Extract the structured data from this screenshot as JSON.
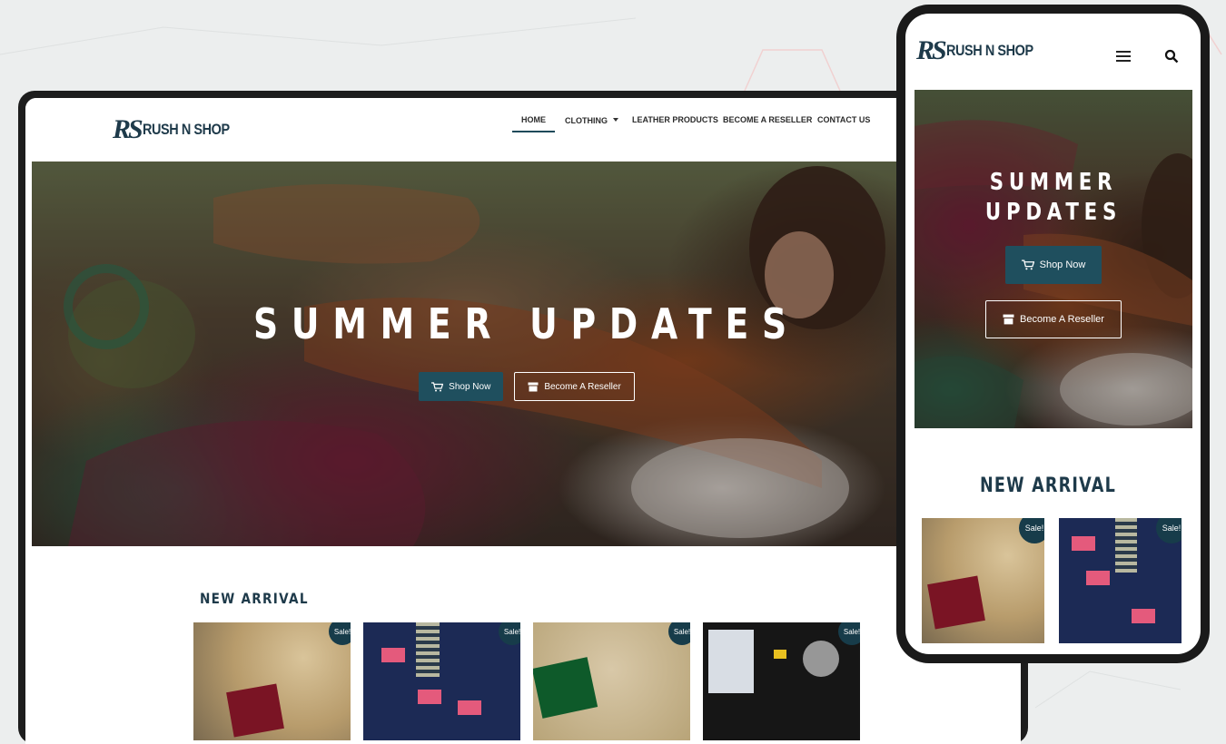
{
  "brand": {
    "logo_mark": "RS",
    "logo_text": "RUSH N SHOP"
  },
  "desktop": {
    "nav": [
      {
        "label": "HOME",
        "active": true
      },
      {
        "label": "CLOTHING",
        "has_dropdown": true
      },
      {
        "label": "LEATHER PRODUCTS"
      },
      {
        "label": "BECOME A RESELLER"
      },
      {
        "label": "CONTACT US"
      }
    ],
    "hero": {
      "title": "SUMMER UPDATES",
      "shop_button": "Shop Now",
      "reseller_button": "Become A Reseller"
    },
    "new_arrival": {
      "heading": "NEW ARRIVAL",
      "products": [
        {
          "badge": "Sale!"
        },
        {
          "badge": "Sale!"
        },
        {
          "badge": "Sale!"
        },
        {
          "badge": "Sale!"
        }
      ]
    }
  },
  "mobile": {
    "hero": {
      "title_line1": "SUMMER",
      "title_line2": "UPDATES",
      "shop_button": "Shop Now",
      "reseller_button": "Become A Reseller"
    },
    "new_arrival": {
      "heading": "NEW ARRIVAL",
      "products": [
        {
          "badge": "Sale!"
        },
        {
          "badge": "Sale!"
        }
      ]
    }
  },
  "icons": {
    "cart": "shopping-cart-icon",
    "store": "store-icon",
    "menu": "hamburger-menu-icon",
    "search": "search-icon",
    "dropdown": "chevron-down-icon"
  },
  "colors": {
    "brand_dark": "#1e3a4a",
    "button_primary": "#1f4f5e",
    "sale_badge": "#173c4a"
  }
}
